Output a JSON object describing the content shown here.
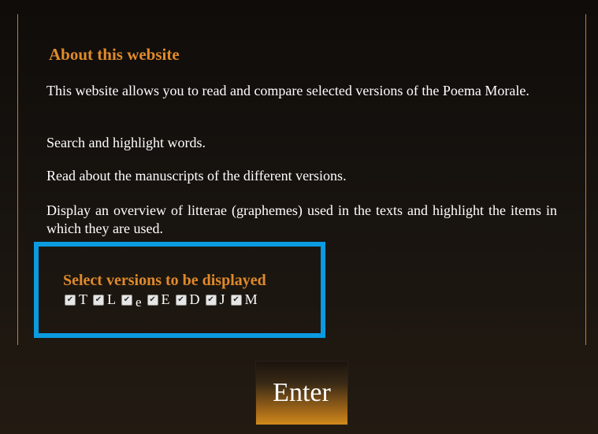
{
  "about": {
    "heading": "About this website",
    "paragraphs": [
      "This website allows you to read and compare selected versions of the Poema Morale.",
      "Search and highlight words.",
      "Read about the manuscripts of the different versions.",
      "Display an overview of litterae (graphemes) used in the texts and highlight the items in which they are used."
    ]
  },
  "version_select": {
    "title": "Select versions to be displayed",
    "versions": [
      {
        "label": "T",
        "checked": true
      },
      {
        "label": "L",
        "checked": true
      },
      {
        "label": "e",
        "checked": true
      },
      {
        "label": "E",
        "checked": true
      },
      {
        "label": "D",
        "checked": true
      },
      {
        "label": "J",
        "checked": true
      },
      {
        "label": "M",
        "checked": true
      }
    ]
  },
  "enter_button": {
    "label": "Enter"
  },
  "colors": {
    "accent": "#e08a2a",
    "highlight_border": "#0a9be0",
    "background": "#1a1510"
  }
}
